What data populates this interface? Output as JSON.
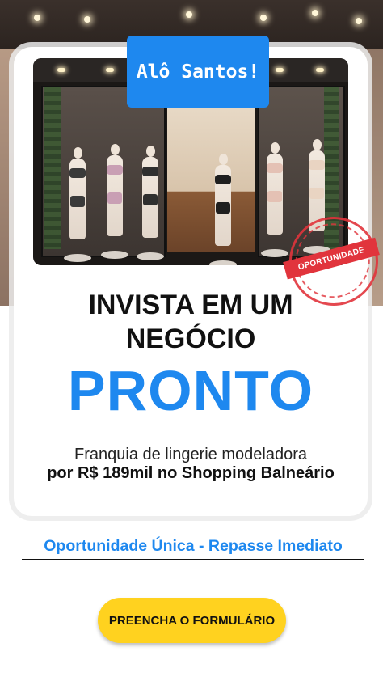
{
  "badge": {
    "text": "Alô Santos!"
  },
  "stamp": {
    "text": "OPORTUNIDADE"
  },
  "headline": {
    "line1": "INVISTA EM UM",
    "line2": "NEGÓCIO",
    "highlight": "PRONTO"
  },
  "description": {
    "line1": "Franquia de lingerie modeladora",
    "line2": "por R$ 189mil  no Shopping Balneário"
  },
  "tagline": "Oportunidade Única - Repasse Imediato",
  "cta": {
    "label": "PREENCHA O FORMULÁRIO"
  },
  "colors": {
    "accent": "#1e88ef",
    "cta": "#ffd21f",
    "stamp": "#e1343c",
    "text": "#111111"
  },
  "image": {
    "subject": "store-front-photo"
  }
}
